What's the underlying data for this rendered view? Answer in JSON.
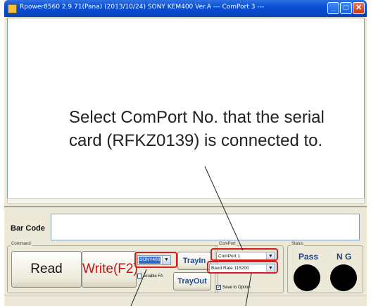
{
  "window": {
    "title": "Rpower8560 2.9.71(Pana) (2013/10/24)  SONY KEM400 Ver.A --- ComPort 3 ---",
    "minimize": "_",
    "maximize": "□",
    "close": "✕"
  },
  "annotation": {
    "line1": "Select ComPort No. that the serial",
    "line2": "card (RFKZ0139) is connected to."
  },
  "barcode": {
    "label": "Bar Code",
    "value": ""
  },
  "command": {
    "group_title": "Command",
    "read_label": "Read",
    "write_label": "Write(F2)",
    "model_value": "SONY400",
    "enable_fa_label": "Enable FA",
    "enable_fa_checked": false,
    "trayin_label": "TrayIn",
    "trayout_label": "TrayOut"
  },
  "comport": {
    "group_title": "ComPort",
    "port_value": "ComPort 1",
    "baud_value": "Baud Rate 115200",
    "save_label": "Save to Option",
    "save_checked": true
  },
  "status": {
    "group_title": "Status",
    "pass_label": "Pass",
    "ng_label": "N G"
  },
  "colors": {
    "highlight": "#d81b1b",
    "title_bar": "#0a4fd6",
    "face": "#ece9d8"
  }
}
